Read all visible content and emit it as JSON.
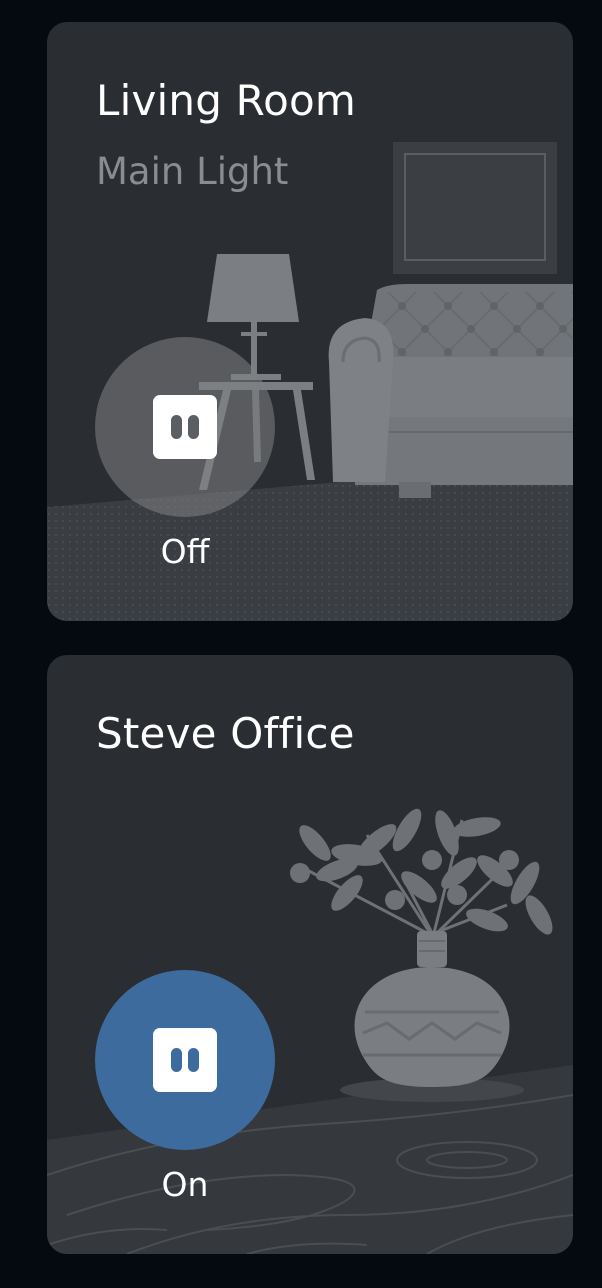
{
  "devices": [
    {
      "name": "Living Room",
      "subtitle": "Main Light",
      "state": "Off",
      "is_on": false,
      "icon": "smart-plug-icon",
      "illustration": "living-room-lamp-sofa"
    },
    {
      "name": "Steve Office",
      "state": "On",
      "is_on": true,
      "icon": "smart-plug-icon",
      "illustration": "plant-vase-wood-floor"
    }
  ],
  "colors": {
    "background": "#050a11",
    "card": "#2a2d31",
    "on_accent": "#3e6b9e",
    "off_button": "#6c6e71"
  }
}
